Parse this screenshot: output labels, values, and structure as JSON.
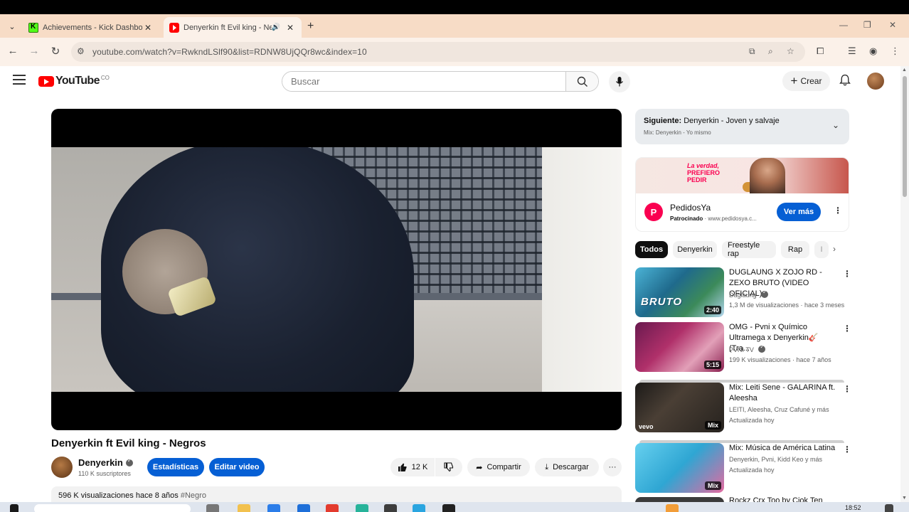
{
  "browser": {
    "tabs": [
      {
        "title": "Achievements - Kick Dashboard",
        "active": false,
        "favicon": "kick-icon"
      },
      {
        "title": "Denyerkin ft Evil king - Neg",
        "active": true,
        "favicon": "youtube-icon",
        "audio": true
      }
    ],
    "url": "youtube.com/watch?v=RwkndLSlf90&list=RDNW8UjQQr8wc&index=10"
  },
  "youtube": {
    "logo_text": "YouTube",
    "country_code": "CO",
    "search_placeholder": "Buscar",
    "create_label": "Crear"
  },
  "video": {
    "title": "Denyerkin ft Evil king - Negros",
    "channel": "Denyerkin",
    "subscribers": "110 K suscriptores",
    "stats_button": "Estadísticas",
    "edit_button": "Editar video",
    "likes": "12 K",
    "share_label": "Compartir",
    "download_label": "Descargar",
    "views": "596 K visualizaciones",
    "age": "hace 8 años",
    "hashtag": "#Negro"
  },
  "up_next": {
    "label": "Siguiente:",
    "title": "Denyerkin - Joven y salvaje",
    "sub": "Mix: Denyerkin - Yo mismo"
  },
  "ad": {
    "banner_line1": "La verdad,",
    "banner_line2": "PREFIERO",
    "banner_line3": "PEDIR",
    "logo_letter": "P",
    "name": "PedidosYa",
    "sponsored": "Patrocinado",
    "domain": "· www.pedidosya.c...",
    "cta": "Ver más"
  },
  "chips": [
    "Todos",
    "Denyerkin",
    "Freestyle rap",
    "Rap",
    "I"
  ],
  "recommendations": [
    {
      "title": "DUGLAUNG X ZOJO RD - ZEXO BRUTO (VIDEO OFICIAL)",
      "channel": "Duglaung",
      "meta": "1,3 M de visualizaciones · hace 3 meses",
      "badge": "2:40",
      "thumb_text": "BRUTO"
    },
    {
      "title": "OMG - Pvni x Químico Ultramega x Denyerkin🎸 (Tra...",
      "channel": "PVNI TV",
      "meta": "199 K visualizaciones · hace 7 años",
      "badge": "5:15"
    },
    {
      "title": "Mix: Leiti Sene - GALARINA ft. Aleesha",
      "channel": "LEITI, Aleesha, Cruz Cafuné y más",
      "meta": "Actualizada hoy",
      "badge": "Mix",
      "vevo": "vevo"
    },
    {
      "title": "Mix: Música de América Latina",
      "channel": "Denyerkin, Pvni, Kidd Keo y más",
      "meta": "Actualizada hoy",
      "badge": "Mix"
    }
  ],
  "partial_rec": {
    "title": "Rockz Crx Too by Cjok Ten"
  },
  "taskbar": {
    "clock": "18:52"
  }
}
